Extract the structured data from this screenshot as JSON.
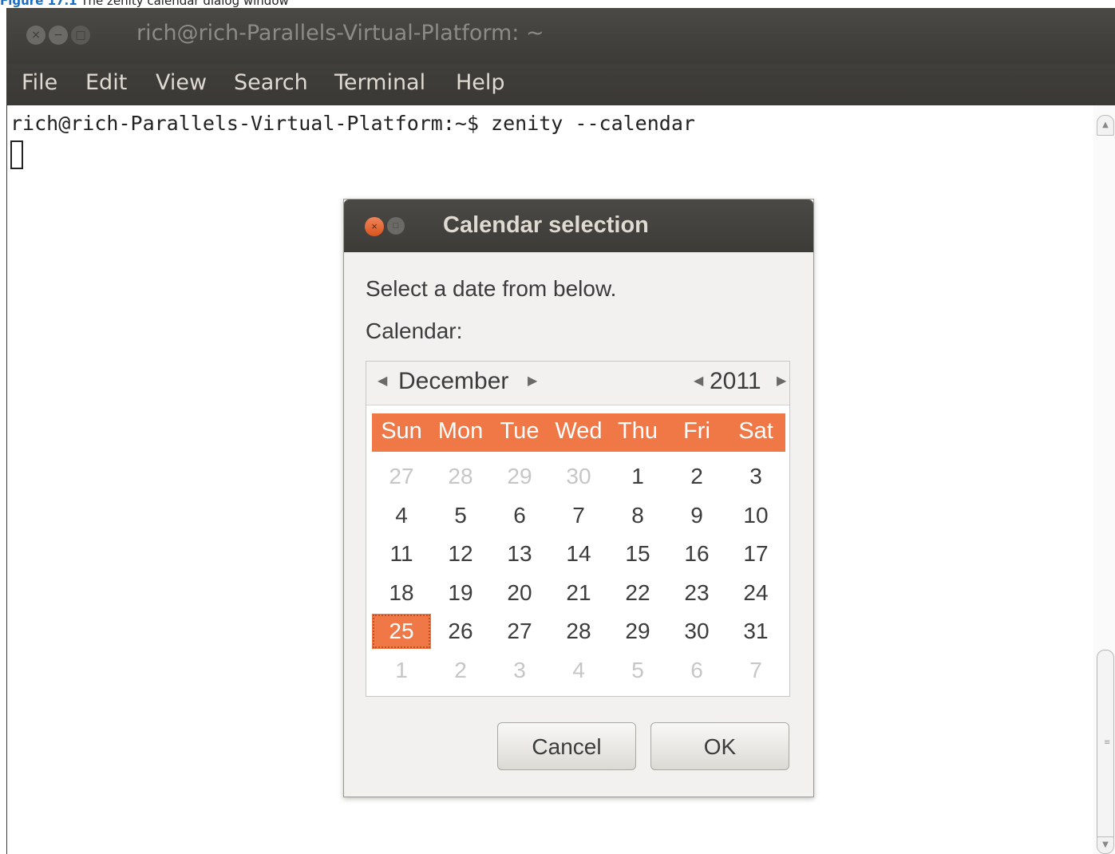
{
  "caption": {
    "number": "Figure 17.1",
    "text": "The zenity calendar dialog window"
  },
  "window": {
    "title": "rich@rich-Parallels-Virtual-Platform: ~",
    "menu": [
      "File",
      "Edit",
      "View",
      "Search",
      "Terminal",
      "Help"
    ]
  },
  "terminal": {
    "line1": "rich@rich-Parallels-Virtual-Platform:~$ zenity --calendar"
  },
  "dialog": {
    "title": "Calendar selection",
    "prompt": "Select a date from below.",
    "label": "Calendar:",
    "month": "December",
    "year": "2011",
    "day_names": [
      "Sun",
      "Mon",
      "Tue",
      "Wed",
      "Thu",
      "Fri",
      "Sat"
    ],
    "weeks": [
      [
        "27",
        "28",
        "29",
        "30",
        "1",
        "2",
        "3"
      ],
      [
        "4",
        "5",
        "6",
        "7",
        "8",
        "9",
        "10"
      ],
      [
        "11",
        "12",
        "13",
        "14",
        "15",
        "16",
        "17"
      ],
      [
        "18",
        "19",
        "20",
        "21",
        "22",
        "23",
        "24"
      ],
      [
        "25",
        "26",
        "27",
        "28",
        "29",
        "30",
        "31"
      ],
      [
        "1",
        "2",
        "3",
        "4",
        "5",
        "6",
        "7"
      ]
    ],
    "selected_day": "25",
    "cancel_label": "Cancel",
    "ok_label": "OK"
  },
  "colors": {
    "accent": "#f07746",
    "titlebar": "#3c3b37",
    "menu_text": "#dfdbd2",
    "dialog_bg": "#f2f1f0"
  }
}
